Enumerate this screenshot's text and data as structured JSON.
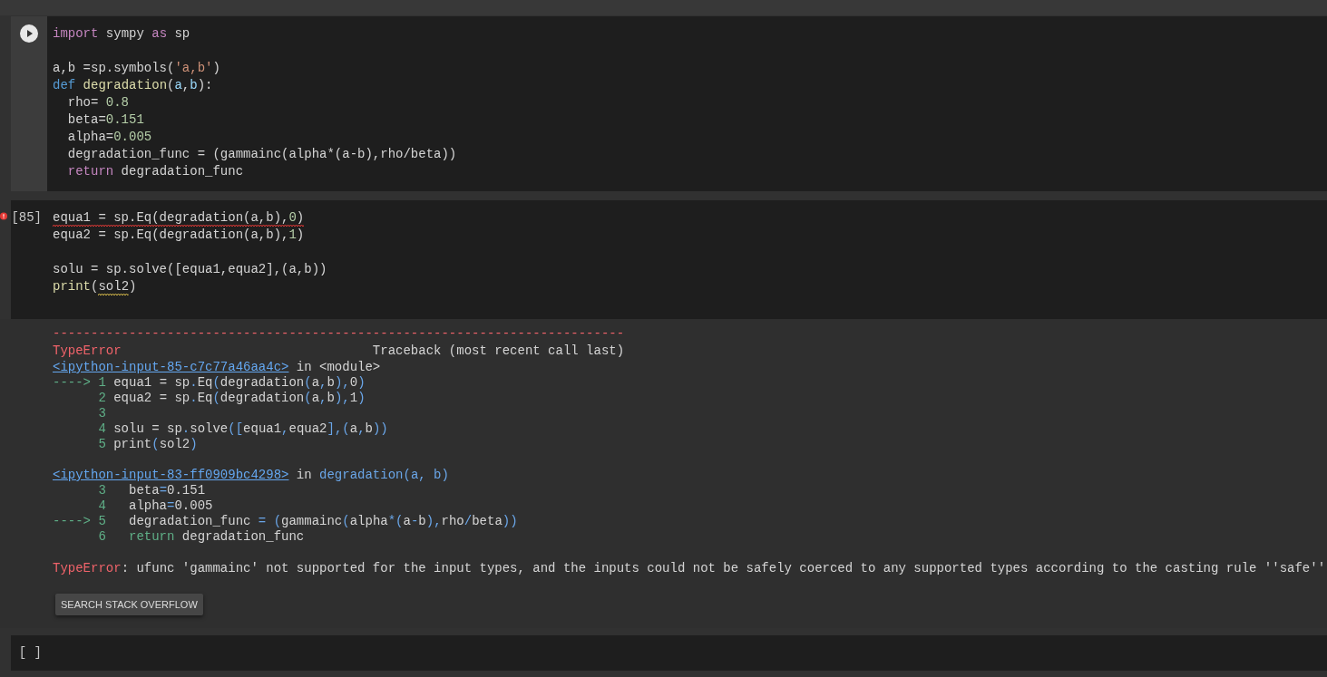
{
  "cells": [
    {
      "kind": "code",
      "run_button": true,
      "lines": [
        {
          "kind": "code",
          "tokens": [
            {
              "text": "import",
              "kind": "kw"
            },
            {
              "text": " sympy ",
              "kind": "plain"
            },
            {
              "text": "as",
              "kind": "kw"
            },
            {
              "text": " sp",
              "kind": "plain"
            }
          ]
        },
        {
          "kind": "blank"
        },
        {
          "kind": "code",
          "tokens": [
            {
              "text": "a,b =sp.symbols(",
              "kind": "plain"
            },
            {
              "text": "'a,b'",
              "kind": "str"
            },
            {
              "text": ")",
              "kind": "plain"
            }
          ]
        },
        {
          "kind": "code",
          "tokens": [
            {
              "text": "def",
              "kind": "def"
            },
            {
              "text": " degradation",
              "kind": "fn"
            },
            {
              "text": "(",
              "kind": "plain"
            },
            {
              "text": "a",
              "kind": "param"
            },
            {
              "text": ",",
              "kind": "plain"
            },
            {
              "text": "b",
              "kind": "param"
            },
            {
              "text": "):",
              "kind": "plain"
            }
          ]
        },
        {
          "kind": "code",
          "tokens": [
            {
              "text": "  rho= ",
              "kind": "plain"
            },
            {
              "text": "0.8",
              "kind": "num"
            }
          ]
        },
        {
          "kind": "code",
          "tokens": [
            {
              "text": "  beta=",
              "kind": "plain"
            },
            {
              "text": "0.151",
              "kind": "num"
            }
          ]
        },
        {
          "kind": "code",
          "tokens": [
            {
              "text": "  alpha=",
              "kind": "plain"
            },
            {
              "text": "0.005",
              "kind": "num"
            }
          ]
        },
        {
          "kind": "code",
          "tokens": [
            {
              "text": "  degradation_func = (gammainc(alpha*(a-b),rho/beta))",
              "kind": "plain"
            }
          ]
        },
        {
          "kind": "code",
          "tokens": [
            {
              "text": "  return",
              "kind": "kw"
            },
            {
              "text": " degradation_func",
              "kind": "plain"
            }
          ]
        }
      ]
    },
    {
      "kind": "code",
      "run_button": false,
      "exec_count": "[85]",
      "error": true,
      "lines": [
        {
          "kind": "code",
          "tokens": [
            {
              "text": "equa1 = sp.Eq(degradation(a,b),",
              "kind": "plain",
              "error_squiggle": true
            },
            {
              "text": "0",
              "kind": "num",
              "error_squiggle": true
            },
            {
              "text": ")",
              "kind": "plain",
              "error_squiggle": true
            }
          ]
        },
        {
          "kind": "code",
          "tokens": [
            {
              "text": "equa2 = sp.Eq(degradation(a,b),",
              "kind": "plain"
            },
            {
              "text": "1",
              "kind": "num"
            },
            {
              "text": ")",
              "kind": "plain"
            }
          ]
        },
        {
          "kind": "blank"
        },
        {
          "kind": "code",
          "tokens": [
            {
              "text": "solu = sp.solve([equa1,equa2],(a,b))",
              "kind": "plain"
            }
          ]
        },
        {
          "kind": "code",
          "tokens": [
            {
              "text": "print",
              "kind": "fn"
            },
            {
              "text": "(",
              "kind": "plain"
            },
            {
              "text": "sol2",
              "kind": "plain",
              "warning_squiggle": true
            },
            {
              "text": ")",
              "kind": "plain"
            }
          ]
        }
      ],
      "output": {
        "rule": "---------------------------------------------------------------------------",
        "error_name": "TypeError",
        "traceback_title": "Traceback (most recent call last)",
        "frames": [
          {
            "link": "<ipython-input-85-c7c77a46aa4c>",
            "location": [
              {
                "text": " in ",
                "kind": "plain"
              },
              {
                "text": "<module>",
                "kind": "plain"
              }
            ],
            "lines": [
              [
                {
                  "text": "----> 1 ",
                  "kind": "green"
                },
                {
                  "text": "equa1 = sp",
                  "kind": "plain"
                },
                {
                  "text": ".",
                  "kind": "blue"
                },
                {
                  "text": "Eq",
                  "kind": "plain"
                },
                {
                  "text": "(",
                  "kind": "blue"
                },
                {
                  "text": "degradation",
                  "kind": "plain"
                },
                {
                  "text": "(",
                  "kind": "blue"
                },
                {
                  "text": "a",
                  "kind": "plain"
                },
                {
                  "text": ",",
                  "kind": "blue"
                },
                {
                  "text": "b",
                  "kind": "plain"
                },
                {
                  "text": "),",
                  "kind": "blue"
                },
                {
                  "text": "0",
                  "kind": "plain"
                },
                {
                  "text": ")",
                  "kind": "blue"
                }
              ],
              [
                {
                  "text": "      2 ",
                  "kind": "green"
                },
                {
                  "text": "equa2 = sp",
                  "kind": "plain"
                },
                {
                  "text": ".",
                  "kind": "blue"
                },
                {
                  "text": "Eq",
                  "kind": "plain"
                },
                {
                  "text": "(",
                  "kind": "blue"
                },
                {
                  "text": "degradation",
                  "kind": "plain"
                },
                {
                  "text": "(",
                  "kind": "blue"
                },
                {
                  "text": "a",
                  "kind": "plain"
                },
                {
                  "text": ",",
                  "kind": "blue"
                },
                {
                  "text": "b",
                  "kind": "plain"
                },
                {
                  "text": "),",
                  "kind": "blue"
                },
                {
                  "text": "1",
                  "kind": "plain"
                },
                {
                  "text": ")",
                  "kind": "blue"
                }
              ],
              [
                {
                  "text": "      3",
                  "kind": "green"
                }
              ],
              [
                {
                  "text": "      4 ",
                  "kind": "green"
                },
                {
                  "text": "solu = sp",
                  "kind": "plain"
                },
                {
                  "text": ".",
                  "kind": "blue"
                },
                {
                  "text": "solve",
                  "kind": "plain"
                },
                {
                  "text": "([",
                  "kind": "blue"
                },
                {
                  "text": "equa1",
                  "kind": "plain"
                },
                {
                  "text": ",",
                  "kind": "blue"
                },
                {
                  "text": "equa2",
                  "kind": "plain"
                },
                {
                  "text": "],(",
                  "kind": "blue"
                },
                {
                  "text": "a",
                  "kind": "plain"
                },
                {
                  "text": ",",
                  "kind": "blue"
                },
                {
                  "text": "b",
                  "kind": "plain"
                },
                {
                  "text": "))",
                  "kind": "blue"
                }
              ],
              [
                {
                  "text": "      5 ",
                  "kind": "green"
                },
                {
                  "text": "print",
                  "kind": "plain"
                },
                {
                  "text": "(",
                  "kind": "blue"
                },
                {
                  "text": "sol2",
                  "kind": "plain"
                },
                {
                  "text": ")",
                  "kind": "blue"
                }
              ]
            ]
          },
          {
            "link": "<ipython-input-83-ff0909bc4298>",
            "location": [
              {
                "text": " in ",
                "kind": "plain"
              },
              {
                "text": "degradation(a, b)",
                "kind": "blue"
              }
            ],
            "lines": [
              [
                {
                  "text": "      3   ",
                  "kind": "green"
                },
                {
                  "text": "beta",
                  "kind": "plain"
                },
                {
                  "text": "=",
                  "kind": "blue"
                },
                {
                  "text": "0.151",
                  "kind": "plain"
                }
              ],
              [
                {
                  "text": "      4   ",
                  "kind": "green"
                },
                {
                  "text": "alpha",
                  "kind": "plain"
                },
                {
                  "text": "=",
                  "kind": "blue"
                },
                {
                  "text": "0.005",
                  "kind": "plain"
                }
              ],
              [
                {
                  "text": "----> 5   ",
                  "kind": "green"
                },
                {
                  "text": "degradation_func ",
                  "kind": "plain"
                },
                {
                  "text": "= (",
                  "kind": "blue"
                },
                {
                  "text": "gammainc",
                  "kind": "plain"
                },
                {
                  "text": "(",
                  "kind": "blue"
                },
                {
                  "text": "alpha",
                  "kind": "plain"
                },
                {
                  "text": "*(",
                  "kind": "blue"
                },
                {
                  "text": "a",
                  "kind": "plain"
                },
                {
                  "text": "-",
                  "kind": "blue"
                },
                {
                  "text": "b",
                  "kind": "plain"
                },
                {
                  "text": "),",
                  "kind": "blue"
                },
                {
                  "text": "rho",
                  "kind": "plain"
                },
                {
                  "text": "/",
                  "kind": "blue"
                },
                {
                  "text": "beta",
                  "kind": "plain"
                },
                {
                  "text": "))",
                  "kind": "blue"
                }
              ],
              [
                {
                  "text": "      6   ",
                  "kind": "green"
                },
                {
                  "text": "return",
                  "kind": "green"
                },
                {
                  "text": " degradation_func",
                  "kind": "plain"
                }
              ]
            ]
          }
        ],
        "message": [
          {
            "text": "TypeError",
            "kind": "red"
          },
          {
            "text": ": ufunc 'gammainc' not supported for the input types, and the inputs could not be safely coerced to any supported types according to the casting rule ''safe''",
            "kind": "plain"
          }
        ],
        "button": "SEARCH STACK OVERFLOW"
      }
    },
    {
      "kind": "code",
      "run_button": false,
      "exec_count": "[ ]"
    }
  ]
}
